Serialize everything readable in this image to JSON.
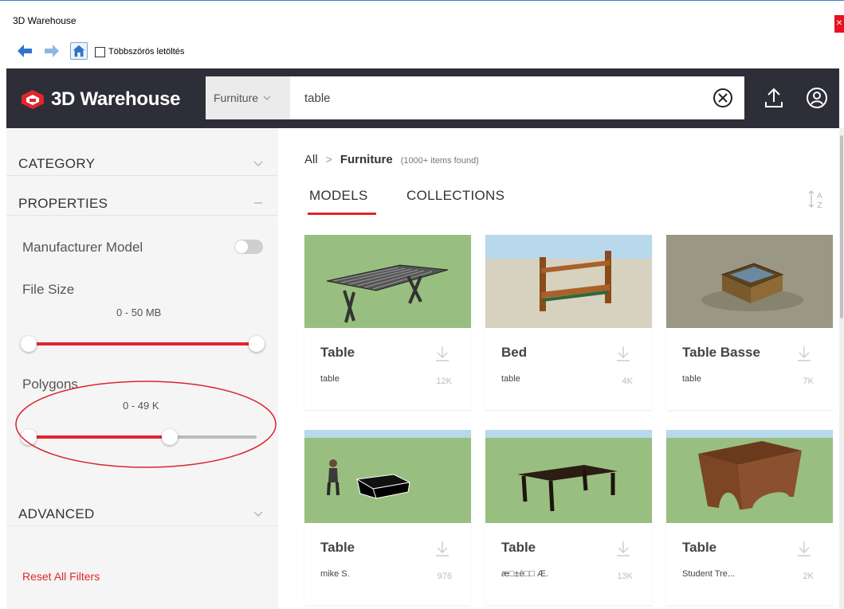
{
  "window": {
    "title": "3D Warehouse",
    "close_icon": "close-icon"
  },
  "toolbar": {
    "back_icon": "arrow-left-icon",
    "forward_icon": "arrow-right-icon",
    "home_icon": "home-icon",
    "multi_download_label": "Többszörös letöltés",
    "multi_download_checked": false
  },
  "header": {
    "logo_text": "3D Warehouse",
    "category_select": "Furniture",
    "search_value": "table",
    "search_placeholder": "",
    "colors": {
      "bar": "#2d2e38",
      "accent": "#e0262b"
    }
  },
  "sidebar": {
    "sections": {
      "category": "CATEGORY",
      "properties": "PROPERTIES",
      "advanced": "ADVANCED"
    },
    "manufacturer_model": {
      "label": "Manufacturer Model",
      "on": false
    },
    "file_size": {
      "label": "File Size",
      "range": "0 - 50 MB",
      "low": 0,
      "high": 1.0
    },
    "polygons": {
      "label": "Polygons",
      "range": "0 - 49 K",
      "low": 0,
      "high": 0.62
    },
    "reset_label": "Reset All Filters"
  },
  "breadcrumb": {
    "root": "All",
    "current": "Furniture",
    "count": "(1000+ items found)"
  },
  "tabs": [
    {
      "label": "MODELS",
      "active": true
    },
    {
      "label": "COLLECTIONS",
      "active": false
    }
  ],
  "models": [
    {
      "name": "Table",
      "category": "table",
      "size": "12K"
    },
    {
      "name": "Bed",
      "category": "table",
      "size": "4K"
    },
    {
      "name": "Table Basse",
      "category": "table",
      "size": "7K"
    },
    {
      "name": "Table",
      "category": "mike S.",
      "size": "976"
    },
    {
      "name": "Table",
      "category": "æ□±è□□ Æ.",
      "size": "13K"
    },
    {
      "name": "Table",
      "category": "Student Tre...",
      "size": "2K"
    }
  ]
}
